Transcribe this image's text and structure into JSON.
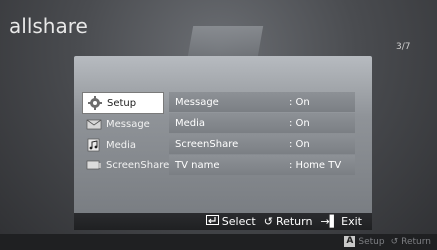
{
  "logo": "allshare",
  "page_counter": "3/7",
  "sidebar": {
    "items": [
      {
        "label": "Setup",
        "icon": "gear-icon",
        "active": true
      },
      {
        "label": "Message",
        "icon": "envelope-icon",
        "active": false
      },
      {
        "label": "Media",
        "icon": "media-icon",
        "active": false
      },
      {
        "label": "ScreenShare",
        "icon": "screen-icon",
        "active": false
      }
    ]
  },
  "settings": [
    {
      "key": "Message",
      "value": ": On"
    },
    {
      "key": "Media",
      "value": ": On"
    },
    {
      "key": "ScreenShare",
      "value": ": On"
    },
    {
      "key": "TV name",
      "value": ": Home TV"
    }
  ],
  "footer": {
    "select": "Select",
    "return": "Return",
    "exit": "Exit"
  },
  "bottom_hints": {
    "setup": "Setup",
    "return": "Return"
  }
}
